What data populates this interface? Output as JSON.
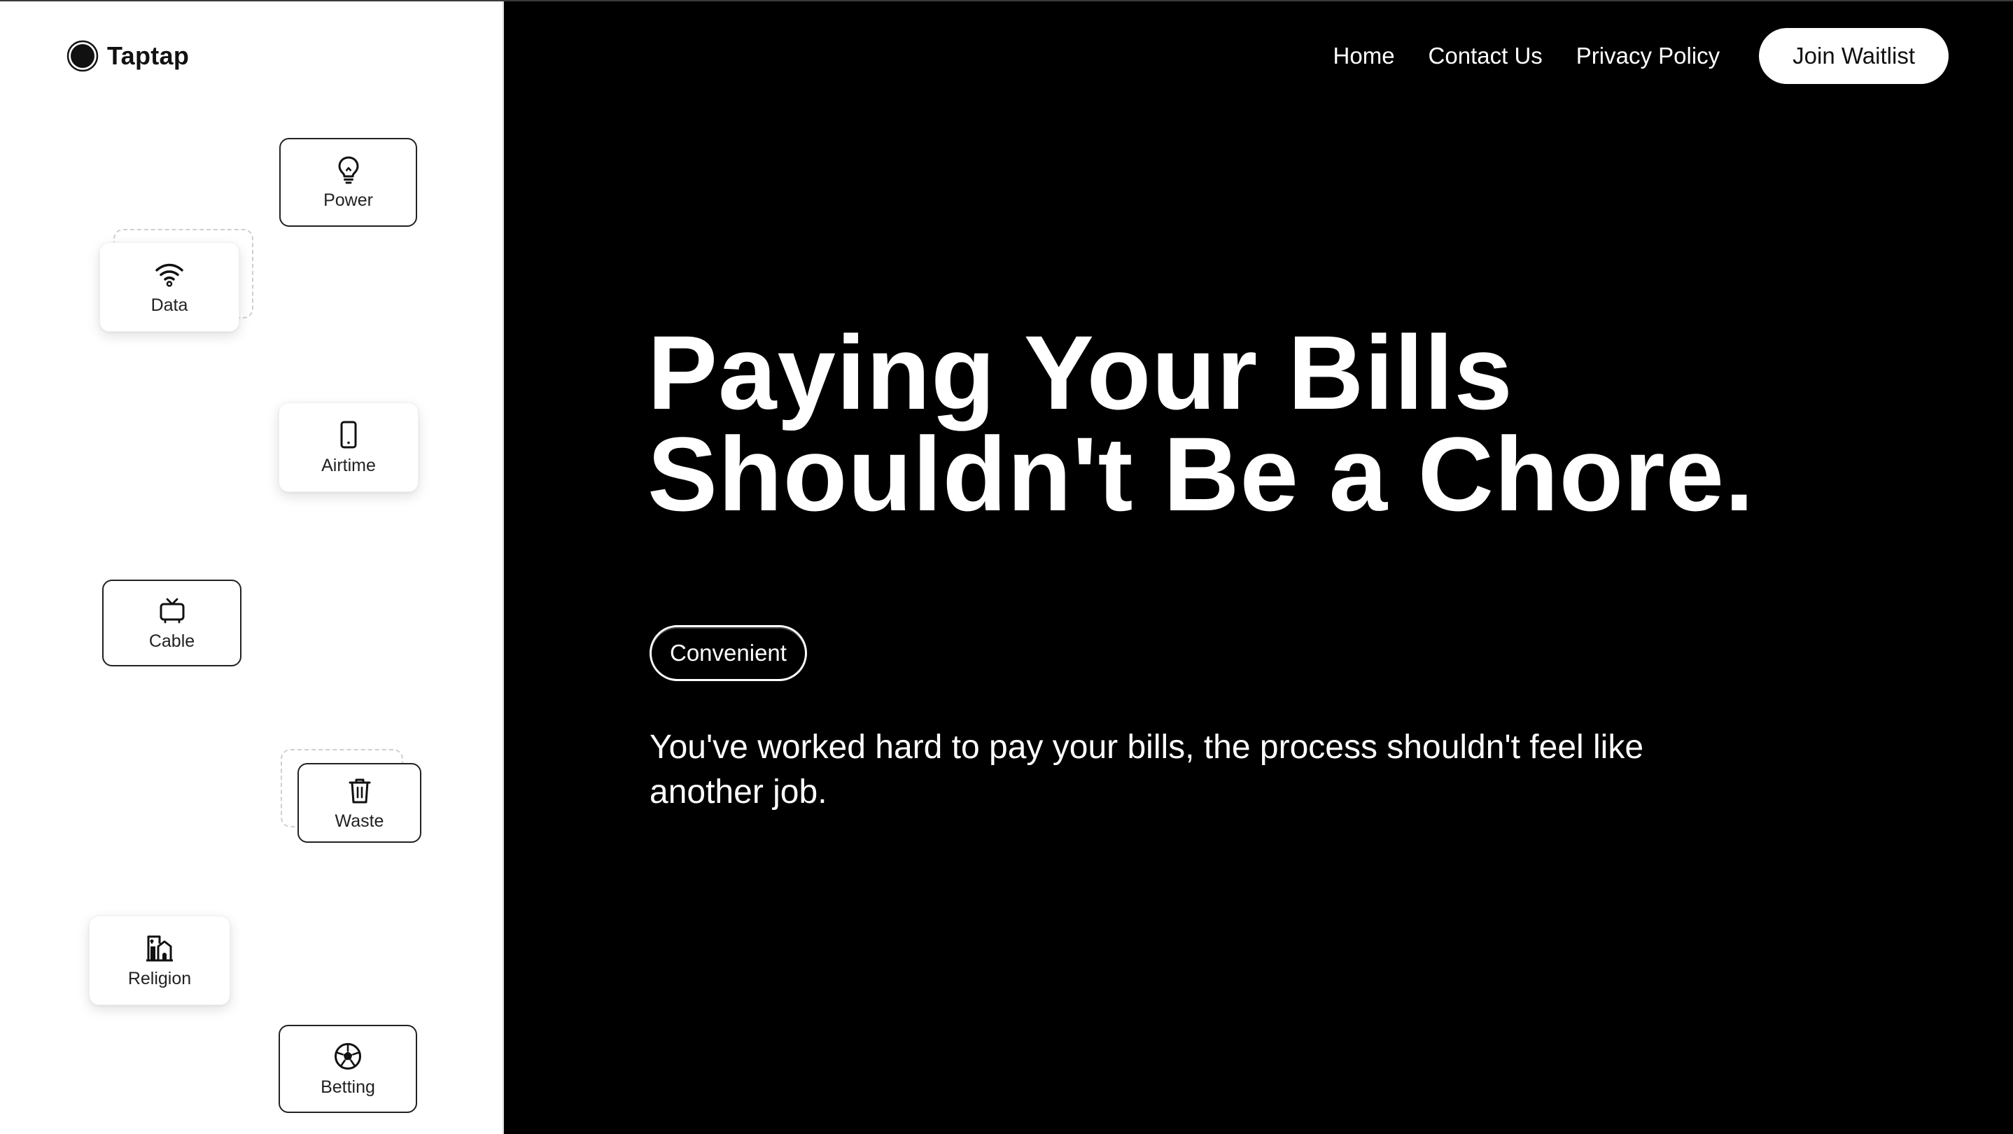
{
  "brand": {
    "name": "Taptap",
    "logo_icon": "filled-circle-logo"
  },
  "nav": {
    "links": [
      {
        "label": "Home"
      },
      {
        "label": "Contact Us"
      },
      {
        "label": "Privacy Policy"
      }
    ],
    "cta_label": "Join Waitlist"
  },
  "services": [
    {
      "label": "Power",
      "icon": "lightbulb-icon"
    },
    {
      "label": "Data",
      "icon": "wifi-icon"
    },
    {
      "label": "Airtime",
      "icon": "phone-icon"
    },
    {
      "label": "Cable",
      "icon": "tv-icon"
    },
    {
      "label": "Waste",
      "icon": "trash-icon"
    },
    {
      "label": "Religion",
      "icon": "church-icon"
    },
    {
      "label": "Betting",
      "icon": "soccer-ball-icon"
    }
  ],
  "hero": {
    "title_line1": "Paying Your Bills",
    "title_line2": "Shouldn't Be a Chore.",
    "pill": "Convenient",
    "subtitle": "You've worked hard to pay your bills, the process shouldn't feel like another job."
  },
  "colors": {
    "background_dark": "#000000",
    "background_light": "#ffffff",
    "text_light": "#ffffff",
    "text_dark": "#111111"
  }
}
